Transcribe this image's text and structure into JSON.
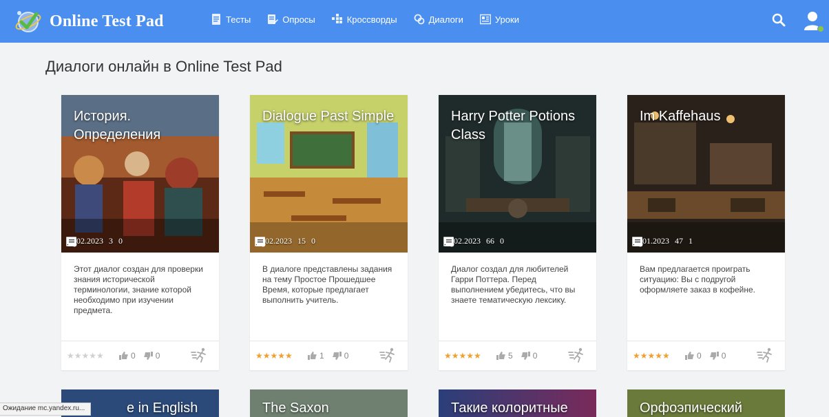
{
  "header": {
    "logo_text": "Online Test Pad",
    "nav": [
      {
        "label": "Тесты",
        "icon": "document-icon"
      },
      {
        "label": "Опросы",
        "icon": "survey-icon"
      },
      {
        "label": "Кроссворды",
        "icon": "crossword-icon"
      },
      {
        "label": "Диалоги",
        "icon": "dialog-icon"
      },
      {
        "label": "Уроки",
        "icon": "lesson-icon"
      }
    ],
    "colors": {
      "bar": "#4a8ff0",
      "user_dot": "#8bc34a"
    }
  },
  "page_title": "Диалоги онлайн в Online Test Pad",
  "cards": [
    {
      "title": "История. Определения",
      "date": "26.02.2023",
      "participants": "3",
      "comments": "0",
      "description": "Этот диалог создан для проверки знания исторической терминологии, знание которой необходимо при изучении предмета.",
      "stars": "★★★★★",
      "rated": false,
      "likes": "0",
      "dislikes": "0"
    },
    {
      "title": "Dialogue Past Simple",
      "date": "19.02.2023",
      "participants": "15",
      "comments": "0",
      "description": "В диалоге представлены задания на тему Простое Прошедшее Время, которые предлагает выполнить учитель.",
      "stars": "★★★★★",
      "rated": true,
      "likes": "1",
      "dislikes": "0"
    },
    {
      "title": "Harry Potter Potions Class",
      "date": "07.02.2023",
      "participants": "66",
      "comments": "0",
      "description": "Диалог создал для любителей Гарри Поттера. Перед выполнением убедитесь, что вы знаете тематическую лексику.",
      "stars": "★★★★★",
      "rated": true,
      "likes": "5",
      "dislikes": "0"
    },
    {
      "title": "Im Kaffehaus",
      "date": "27.01.2023",
      "participants": "47",
      "comments": "1",
      "description": "Вам предлагается проиграть ситуацию: Вы с подругой оформляете заказ в кофейне.",
      "stars": "★★★★★",
      "rated": true,
      "likes": "0",
      "dislikes": "0"
    }
  ],
  "next_row_titles": [
    "e in English",
    "The Saxon",
    "Такие колоритные",
    "Орфоэпический"
  ],
  "status_text": "Ожидание mc.yandex.ru..."
}
